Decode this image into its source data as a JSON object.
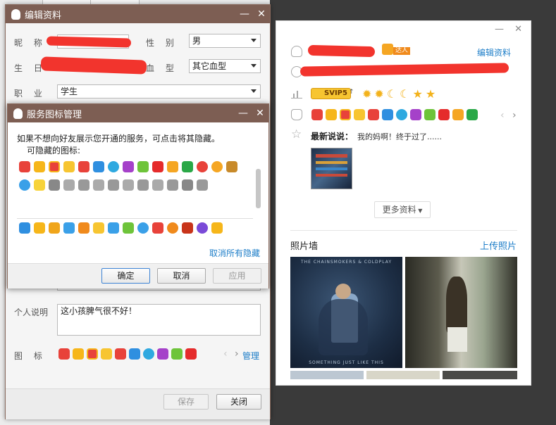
{
  "edit_window": {
    "title": "编辑资料",
    "minimize": "—",
    "close": "✕",
    "nickname_label": "昵 称",
    "gender_label": "性 别",
    "gender_value": "男",
    "birthday_label": "生 日",
    "blood_label": "血 型",
    "blood_value": "其它血型",
    "job_label": "职 业",
    "job_value": "学生",
    "bio_label": "个人说明",
    "bio_value": "这小孩脾气很不好！",
    "icons_label": "图 标",
    "manage_link": "管理",
    "save_button": "保存",
    "close_button": "关闭"
  },
  "service_dialog": {
    "title": "服务图标管理",
    "minimize": "—",
    "close": "✕",
    "hint": "如果不想向好友展示您开通的服务，可点击将其隐藏。",
    "hideable_label": "可隐藏的图标:",
    "cancel_all_link": "取消所有隐藏",
    "ok_button": "确定",
    "cancel_button": "取消",
    "apply_button": "应用"
  },
  "profile_card": {
    "minimize": "—",
    "close": "✕",
    "edit_profile_link": "编辑资料",
    "daren_badge": "达人",
    "svip_badge": "SVIP5",
    "latest_post_label": "最新说说：",
    "latest_post_text": "我的妈啊！终于过了......",
    "more_info_button": "更多资料",
    "photo_wall_label": "照片墙",
    "upload_photo_link": "上传照片",
    "album_top_text": "THE CHAINSMOKERS & COLDPLAY",
    "album_bottom_text": "SOMETHING JUST LIKE THIS"
  },
  "colors": {
    "titlebar": "#7d5e53",
    "link": "#1e7ec8",
    "redaction": "#f2342d"
  }
}
